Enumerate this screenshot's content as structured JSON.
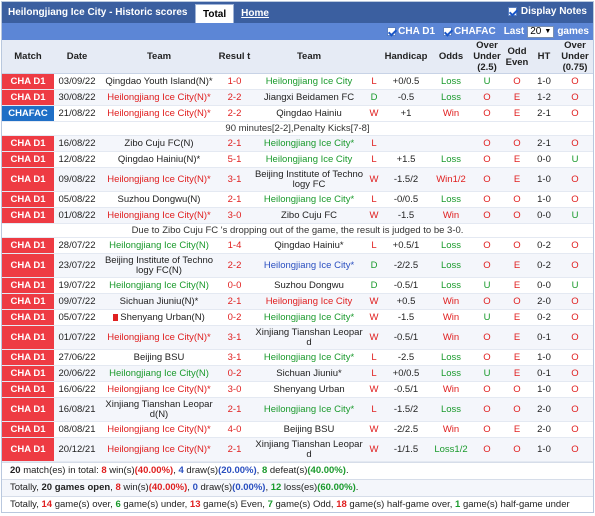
{
  "header": {
    "title": "Heilongjiang Ice City - Historic scores",
    "tab_total": "Total",
    "tab_home": "Home",
    "display_notes": "Display Notes"
  },
  "filters": {
    "f1": "CHA D1",
    "f2": "CHAFAC",
    "last_label": "Last",
    "last_value": "20",
    "games_label": "games"
  },
  "columns": {
    "match": "Match",
    "date": "Date",
    "home": "Team",
    "result": "Resul t",
    "away": "Team",
    "handicap": "Handicap",
    "odds": "Odds",
    "ou": "Over Under (2.5)",
    "oddeven": "Odd Even",
    "ht": "HT",
    "ou2": "Over Under (0.75)"
  },
  "rows": [
    {
      "lg": "CHA D1",
      "date": "03/09/22",
      "home": "Qingdao Youth Island(N)*",
      "hc": "n",
      "res": "1-0",
      "away": "Heilongjiang Ice City",
      "ac": "g",
      "r": "L",
      "rc": "red",
      "hcp": "+0/0.5",
      "odds": "Loss",
      "oc": "g",
      "ou": "U",
      "ouc": "g",
      "oe": "O",
      "oec": "r",
      "ht": "1-0",
      "ou2": "O",
      "ou2c": "r"
    },
    {
      "lg": "CHA D1",
      "date": "30/08/22",
      "home": "Heilongjiang Ice City(N)*",
      "hc": "r",
      "res": "2-2",
      "away": "Jiangxi Beidamen FC",
      "ac": "n",
      "r": "D",
      "rc": "green",
      "hcp": "-0.5",
      "odds": "Loss",
      "oc": "g",
      "ou": "O",
      "ouc": "r",
      "oe": "E",
      "oec": "r",
      "ht": "1-2",
      "ou2": "O",
      "ou2c": "r"
    },
    {
      "lg": "CHAFAC",
      "date": "21/08/22",
      "home": "Heilongjiang Ice City(N)*",
      "hc": "r",
      "res": "2-2",
      "away": "Qingdao Hainiu",
      "ac": "n",
      "r": "W",
      "rc": "red",
      "hcp": "+1",
      "odds": "Win",
      "oc": "r",
      "ou": "O",
      "ouc": "r",
      "oe": "E",
      "oec": "r",
      "ht": "2-1",
      "ou2": "O",
      "ou2c": "r"
    },
    {
      "note": "90 minutes[2-2],Penalty Kicks[7-8]"
    },
    {
      "lg": "CHA D1",
      "date": "16/08/22",
      "home": "Zibo Cuju FC(N)",
      "hc": "n",
      "res": "2-1",
      "away": "Heilongjiang Ice City*",
      "ac": "g",
      "r": "L",
      "rc": "red",
      "hcp": "",
      "odds": "",
      "oc": "g",
      "ou": "O",
      "ouc": "r",
      "oe": "O",
      "oec": "r",
      "ht": "2-1",
      "ou2": "O",
      "ou2c": "r"
    },
    {
      "lg": "CHA D1",
      "date": "12/08/22",
      "home": "Qingdao Hainiu(N)*",
      "hc": "n",
      "res": "5-1",
      "away": "Heilongjiang Ice City",
      "ac": "g",
      "r": "L",
      "rc": "red",
      "hcp": "+1.5",
      "odds": "Loss",
      "oc": "g",
      "ou": "O",
      "ouc": "r",
      "oe": "E",
      "oec": "r",
      "ht": "0-0",
      "ou2": "U",
      "ou2c": "g"
    },
    {
      "lg": "CHA D1",
      "date": "09/08/22",
      "home": "Heilongjiang Ice City(N)*",
      "hc": "r",
      "res": "3-1",
      "away": "Beijing Institute of Techno logy FC",
      "ac": "n",
      "tall": true,
      "r": "W",
      "rc": "red",
      "hcp": "-1.5/2",
      "odds": "Win1/2",
      "oc": "r",
      "ou": "O",
      "ouc": "r",
      "oe": "E",
      "oec": "r",
      "ht": "1-0",
      "ou2": "O",
      "ou2c": "r"
    },
    {
      "lg": "CHA D1",
      "date": "05/08/22",
      "home": "Suzhou Dongwu(N)",
      "hc": "n",
      "res": "2-1",
      "away": "Heilongjiang Ice City*",
      "ac": "g",
      "r": "L",
      "rc": "red",
      "hcp": "-0/0.5",
      "odds": "Loss",
      "oc": "g",
      "ou": "O",
      "ouc": "r",
      "oe": "O",
      "oec": "r",
      "ht": "1-0",
      "ou2": "O",
      "ou2c": "r"
    },
    {
      "lg": "CHA D1",
      "date": "01/08/22",
      "home": "Heilongjiang Ice City(N)*",
      "hc": "r",
      "res": "3-0",
      "away": "Zibo Cuju FC",
      "ac": "n",
      "r": "W",
      "rc": "red",
      "hcp": "-1.5",
      "odds": "Win",
      "oc": "r",
      "ou": "O",
      "ouc": "r",
      "oe": "O",
      "oec": "r",
      "ht": "0-0",
      "ou2": "U",
      "ou2c": "g"
    },
    {
      "note": "Due to Zibo Cuju FC 's dropping out of the game, the result is judged to be 3-0."
    },
    {
      "lg": "CHA D1",
      "date": "28/07/22",
      "home": "Heilongjiang Ice City(N)",
      "hc": "g",
      "res": "1-4",
      "away": "Qingdao Hainiu*",
      "ac": "n",
      "r": "L",
      "rc": "red",
      "hcp": "+0.5/1",
      "odds": "Loss",
      "oc": "g",
      "ou": "O",
      "ouc": "r",
      "oe": "O",
      "oec": "r",
      "ht": "0-2",
      "ou2": "O",
      "ou2c": "r"
    },
    {
      "lg": "CHA D1",
      "date": "23/07/22",
      "home": "Beijing Institute of Techno logy FC(N)",
      "hc": "n",
      "htall": true,
      "res": "2-2",
      "away": "Heilongjiang Ice City*",
      "ac": "b",
      "r": "D",
      "rc": "green",
      "hcp": "-2/2.5",
      "odds": "Loss",
      "oc": "g",
      "ou": "O",
      "ouc": "r",
      "oe": "E",
      "oec": "r",
      "ht": "0-2",
      "ou2": "O",
      "ou2c": "r"
    },
    {
      "lg": "CHA D1",
      "date": "19/07/22",
      "home": "Heilongjiang Ice City(N)",
      "hc": "g",
      "res": "0-0",
      "away": "Suzhou Dongwu",
      "ac": "n",
      "r": "D",
      "rc": "green",
      "hcp": "-0.5/1",
      "odds": "Loss",
      "oc": "g",
      "ou": "U",
      "ouc": "g",
      "oe": "E",
      "oec": "r",
      "ht": "0-0",
      "ou2": "U",
      "ou2c": "g"
    },
    {
      "lg": "CHA D1",
      "date": "09/07/22",
      "home": "Sichuan Jiuniu(N)*",
      "hc": "n",
      "res": "2-1",
      "away": "Heilongjiang Ice City",
      "ac": "r",
      "r": "W",
      "rc": "red",
      "hcp": "+0.5",
      "odds": "Win",
      "oc": "r",
      "ou": "O",
      "ouc": "r",
      "oe": "O",
      "oec": "r",
      "ht": "2-0",
      "ou2": "O",
      "ou2c": "r"
    },
    {
      "lg": "CHA D1",
      "date": "05/07/22",
      "home": "Shenyang Urban(N)",
      "hc": "n",
      "card": true,
      "res": "0-2",
      "away": "Heilongjiang Ice City*",
      "ac": "g",
      "r": "W",
      "rc": "red",
      "hcp": "-1.5",
      "odds": "Win",
      "oc": "r",
      "ou": "U",
      "ouc": "g",
      "oe": "E",
      "oec": "r",
      "ht": "0-2",
      "ou2": "O",
      "ou2c": "r"
    },
    {
      "lg": "CHA D1",
      "date": "01/07/22",
      "home": "Heilongjiang Ice City(N)*",
      "hc": "r",
      "res": "3-1",
      "away": "Xinjiang Tianshan Leopar d",
      "ac": "n",
      "tall": true,
      "r": "W",
      "rc": "red",
      "hcp": "-0.5/1",
      "odds": "Win",
      "oc": "r",
      "ou": "O",
      "ouc": "r",
      "oe": "E",
      "oec": "r",
      "ht": "0-1",
      "ou2": "O",
      "ou2c": "r"
    },
    {
      "lg": "CHA D1",
      "date": "27/06/22",
      "home": "Beijing BSU",
      "hc": "n",
      "res": "3-1",
      "away": "Heilongjiang Ice City*",
      "ac": "g",
      "r": "L",
      "rc": "red",
      "hcp": "-2.5",
      "odds": "Loss",
      "oc": "g",
      "ou": "O",
      "ouc": "r",
      "oe": "E",
      "oec": "r",
      "ht": "1-0",
      "ou2": "O",
      "ou2c": "r"
    },
    {
      "lg": "CHA D1",
      "date": "20/06/22",
      "home": "Heilongjiang Ice City(N)",
      "hc": "g",
      "res": "0-2",
      "away": "Sichuan Jiuniu*",
      "ac": "n",
      "r": "L",
      "rc": "red",
      "hcp": "+0/0.5",
      "odds": "Loss",
      "oc": "g",
      "ou": "U",
      "ouc": "g",
      "oe": "E",
      "oec": "r",
      "ht": "0-1",
      "ou2": "O",
      "ou2c": "r"
    },
    {
      "lg": "CHA D1",
      "date": "16/06/22",
      "home": "Heilongjiang Ice City(N)*",
      "hc": "r",
      "res": "3-0",
      "away": "Shenyang Urban",
      "ac": "n",
      "r": "W",
      "rc": "red",
      "hcp": "-0.5/1",
      "odds": "Win",
      "oc": "r",
      "ou": "O",
      "ouc": "r",
      "oe": "O",
      "oec": "r",
      "ht": "1-0",
      "ou2": "O",
      "ou2c": "r"
    },
    {
      "lg": "CHA D1",
      "date": "16/08/21",
      "home": "Xinjiang Tianshan Leopar d(N)",
      "hc": "n",
      "htall": true,
      "res": "2-1",
      "away": "Heilongjiang Ice City*",
      "ac": "g",
      "r": "L",
      "rc": "red",
      "hcp": "-1.5/2",
      "odds": "Loss",
      "oc": "g",
      "ou": "O",
      "ouc": "r",
      "oe": "O",
      "oec": "r",
      "ht": "2-0",
      "ou2": "O",
      "ou2c": "r"
    },
    {
      "lg": "CHA D1",
      "date": "08/08/21",
      "home": "Heilongjiang Ice City(N)*",
      "hc": "r",
      "res": "4-0",
      "away": "Beijing BSU",
      "ac": "n",
      "r": "W",
      "rc": "red",
      "hcp": "-2/2.5",
      "odds": "Win",
      "oc": "r",
      "ou": "O",
      "ouc": "r",
      "oe": "E",
      "oec": "r",
      "ht": "2-0",
      "ou2": "O",
      "ou2c": "r"
    },
    {
      "lg": "CHA D1",
      "date": "20/12/21",
      "home": "Heilongjiang Ice City(N)*",
      "hc": "r",
      "res": "2-1",
      "away": "Xinjiang Tianshan Leopar d",
      "ac": "n",
      "tall": true,
      "r": "W",
      "rc": "red",
      "hcp": "-1/1.5",
      "odds": "Loss1/2",
      "oc": "g",
      "ou": "O",
      "ouc": "r",
      "oe": "O",
      "oec": "r",
      "ht": "1-0",
      "ou2": "O",
      "ou2c": "r"
    }
  ],
  "footer": {
    "l1": {
      "a": "20",
      "b": " match(es) in total: ",
      "c": "8",
      "d": " win(s)",
      "e": "(40.00%)",
      "f": ", ",
      "g": "4",
      "h": " draw(s)",
      "i": "(20.00%)",
      "j": ", ",
      "k": "8",
      "l": " defeat(s)",
      "m": "(40.00%)",
      "n": "."
    },
    "l2": {
      "a": "Totally, ",
      "b": "20 games open",
      "c": ", ",
      "d": "8",
      "e": " win(s)",
      "f": "(40.00%)",
      "g": ", ",
      "h": "0",
      "i": " draw(s)",
      "j": "(0.00%)",
      "k": ", ",
      "l": "12",
      "m": " loss(es)",
      "n": "(60.00%)",
      "o": "."
    },
    "l3": {
      "a": "Totally, ",
      "b": "14",
      "c": " game(s) over, ",
      "d": "6",
      "e": " game(s) under, ",
      "f": "13",
      "g": " game(s) Even, ",
      "h": "7",
      "i": " game(s) Odd, ",
      "j": "18",
      "k": " game(s) half-game over, ",
      "l": "1",
      "m": " game(s) half-game under"
    }
  }
}
